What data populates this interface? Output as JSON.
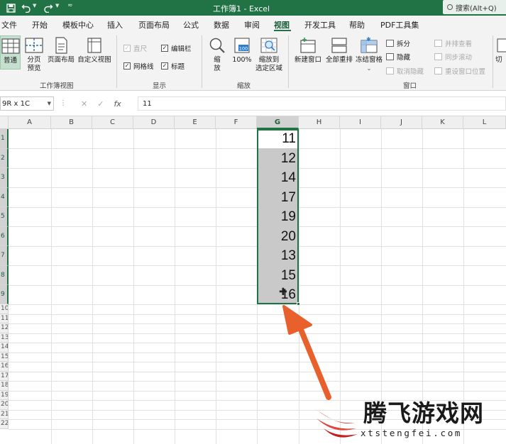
{
  "titlebar": {
    "title": "工作簿1 - Excel",
    "search_placeholder": "搜索(Alt+Q)",
    "icons": [
      "save-icon",
      "undo-icon",
      "redo-icon",
      "customize-qat-icon"
    ]
  },
  "menu": {
    "tabs": [
      "文件",
      "开始",
      "模板中心",
      "插入",
      "页面布局",
      "公式",
      "数据",
      "审阅",
      "视图",
      "开发工具",
      "帮助",
      "PDF工具集"
    ],
    "active": "视图"
  },
  "ribbon": {
    "workbook_views": {
      "label": "工作簿视图",
      "normal": "普通",
      "page_break_1": "分页",
      "page_break_2": "预览",
      "page_layout": "页面布局",
      "custom_views": "自定义视图"
    },
    "show": {
      "label": "显示",
      "ruler": "直尺",
      "formula_bar": "编辑栏",
      "gridlines": "网格线",
      "headings": "标题"
    },
    "zoom": {
      "label": "缩放",
      "zoom_1": "缩",
      "zoom_2": "放",
      "zoom_100": "100%",
      "zoom_sel_1": "缩放到",
      "zoom_sel_2": "选定区域"
    },
    "window": {
      "label": "窗口",
      "new_window": "新建窗口",
      "arrange_all": "全部重排",
      "freeze_panes": "冻结窗格",
      "split": "拆分",
      "hide": "隐藏",
      "unhide": "取消隐藏",
      "side_by_side": "并排查看",
      "sync_scroll": "同步滚动",
      "reset_position": "重设窗口位置",
      "switch": "切"
    }
  },
  "formula_bar": {
    "name_box": "9R x 1C",
    "fx": "fx",
    "value": "11"
  },
  "sheet": {
    "columns": [
      "A",
      "B",
      "C",
      "D",
      "E",
      "F",
      "G",
      "H",
      "I",
      "J",
      "K",
      "L"
    ],
    "selected_column": "G",
    "rows": [
      "1",
      "2",
      "3",
      "4",
      "5",
      "6",
      "7",
      "8",
      "9",
      "10",
      "11",
      "12",
      "13",
      "14",
      "15",
      "16",
      "17",
      "18",
      "19",
      "20",
      "21",
      "22"
    ],
    "g_values": [
      "11",
      "12",
      "14",
      "17",
      "19",
      "20",
      "13",
      "15",
      "16"
    ]
  },
  "watermark": {
    "name": "腾飞游戏网",
    "url": "xtstengfei.com"
  },
  "colors": {
    "excel_green": "#217346",
    "arrow_orange": "#e8612d",
    "selection_gray": "#c9c9c9"
  }
}
